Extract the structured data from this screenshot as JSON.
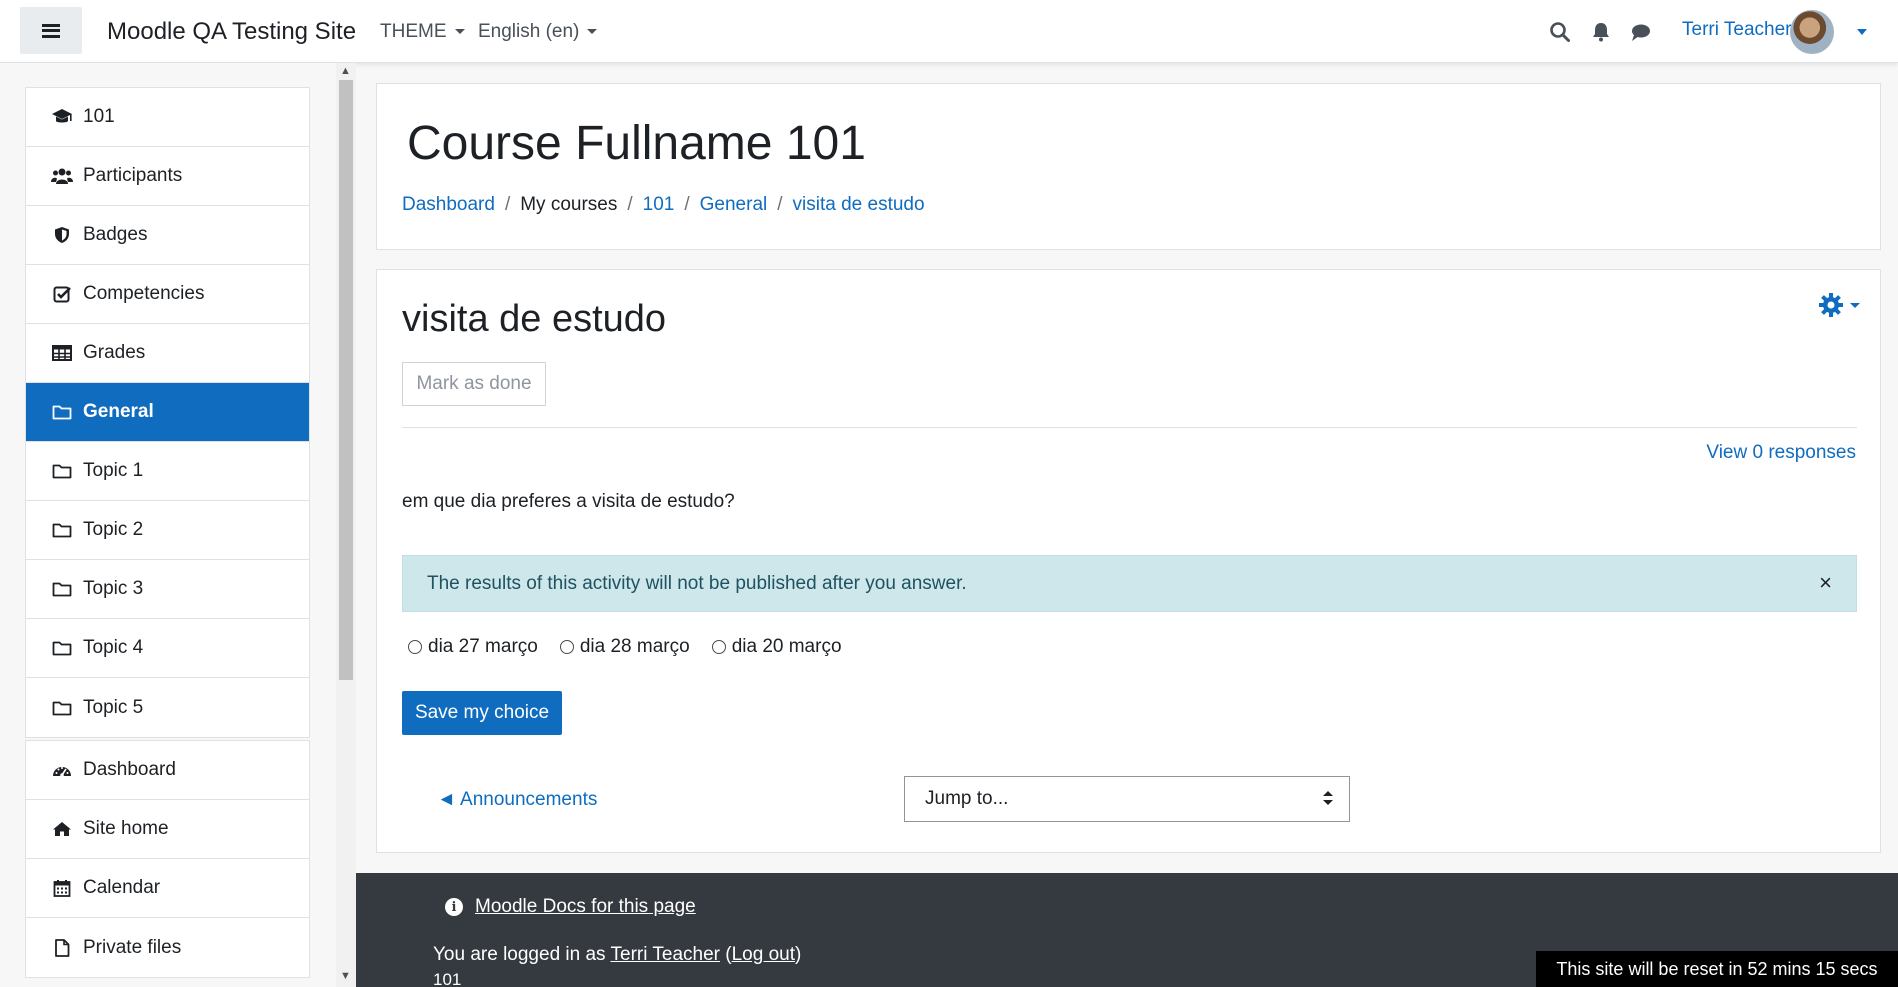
{
  "navbar": {
    "site_name": "Moodle QA Testing Site",
    "theme_menu": "THEME",
    "language_menu": "English (en)",
    "user_name": "Terri Teacher"
  },
  "drawer": {
    "course_items": [
      {
        "label": "101",
        "icon": "graduation-cap-icon"
      },
      {
        "label": "Participants",
        "icon": "users-icon"
      },
      {
        "label": "Badges",
        "icon": "shield-icon"
      },
      {
        "label": "Competencies",
        "icon": "check-square-icon"
      },
      {
        "label": "Grades",
        "icon": "table-icon"
      },
      {
        "label": "General",
        "icon": "folder-icon",
        "active": true
      },
      {
        "label": "Topic 1",
        "icon": "folder-icon"
      },
      {
        "label": "Topic 2",
        "icon": "folder-icon"
      },
      {
        "label": "Topic 3",
        "icon": "folder-icon"
      },
      {
        "label": "Topic 4",
        "icon": "folder-icon"
      },
      {
        "label": "Topic 5",
        "icon": "folder-icon"
      }
    ],
    "site_items": [
      {
        "label": "Dashboard",
        "icon": "dashboard-icon"
      },
      {
        "label": "Site home",
        "icon": "home-icon"
      },
      {
        "label": "Calendar",
        "icon": "calendar-icon"
      },
      {
        "label": "Private files",
        "icon": "file-icon"
      }
    ]
  },
  "header": {
    "title": "Course Fullname 101",
    "breadcrumb": [
      "Dashboard",
      "My courses",
      "101",
      "General",
      "visita de estudo"
    ]
  },
  "activity": {
    "title": "visita de estudo",
    "mark_done": "Mark as done",
    "view_responses": "View 0 responses",
    "question": "em que dia preferes a visita de estudo?",
    "alert": "The results of this activity will not be published after you answer.",
    "alert_close": "×",
    "options": [
      "dia 27 março",
      "dia 28 março",
      "dia 20 março"
    ],
    "save_button": "Save my choice",
    "prev_activity": "◄ Announcements",
    "jump_to": "Jump to..."
  },
  "footer": {
    "docs_link": "Moodle Docs for this page",
    "logged_in_prefix": "You are logged in as ",
    "logged_in_user": "Terri Teacher",
    "logout_open": " (",
    "logout": "Log out",
    "logout_close": ")",
    "course": "101"
  },
  "reset_notice": "This site will be reset in 52 mins 15 secs",
  "colors": {
    "primary": "#0f6cbf",
    "alert_bg": "#cde7ea",
    "footer_bg": "#343a40"
  }
}
